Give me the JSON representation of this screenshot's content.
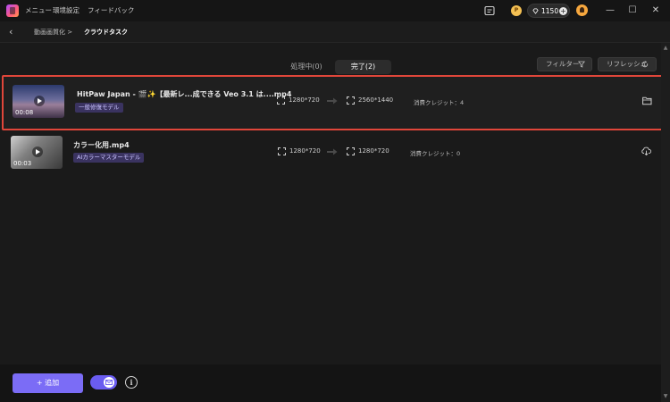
{
  "titlebar": {
    "menu": [
      "メニュー",
      "環境設定",
      "フィードバック"
    ],
    "credits": "1150",
    "coin_label": "P"
  },
  "breadcrumb": {
    "parent": "動画画質化",
    "current": "クラウドタスク"
  },
  "tabs": [
    {
      "label": "処理中(0)",
      "active": false
    },
    {
      "label": "完了(2)",
      "active": true
    }
  ],
  "toolbar": {
    "filter_label": "フィルター",
    "refresh_label": "リフレッシュ"
  },
  "tasks": [
    {
      "file_name": "HitPaw Japan - 🎬✨【最新レ...成できる Veo 3.1 は....mp4",
      "duration": "00:08",
      "model": "一般修復モデル",
      "input_res": "1280*720",
      "output_res": "2560*1440",
      "credit_label": "消費クレジット：4"
    },
    {
      "file_name": "カラー化用.mp4",
      "duration": "00:03",
      "model": "AIカラーマスターモデル",
      "input_res": "1280*720",
      "output_res": "1280*720",
      "credit_label": "消費クレジット：0"
    }
  ],
  "footer": {
    "add_label": "+ 追加",
    "info_label": "i"
  },
  "colors": {
    "accent": "#7b6cf6",
    "selected_border": "#e0463a",
    "badge_bg": "#3a3360"
  }
}
